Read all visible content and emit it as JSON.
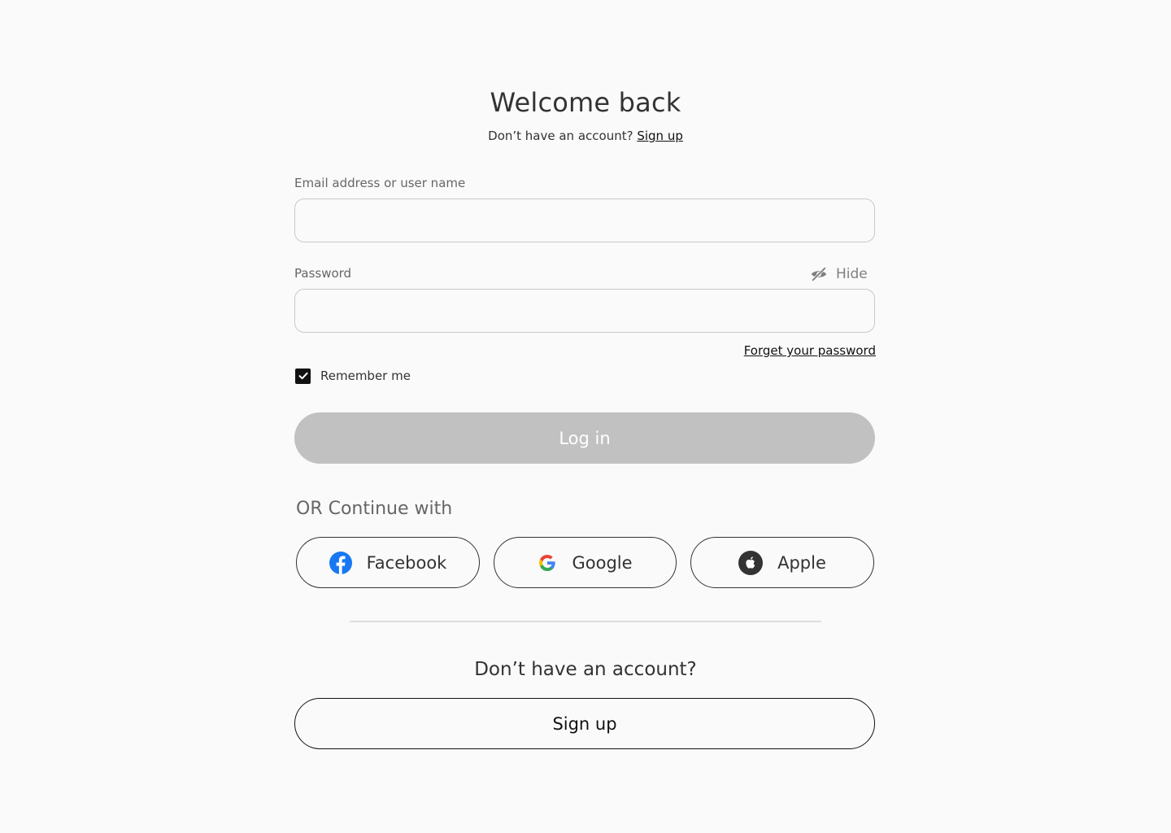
{
  "header": {
    "title": "Welcome back",
    "subtitle_prefix": "Don’t have an account?",
    "signup_link": "Sign up"
  },
  "form": {
    "email": {
      "label": "Email address or user name",
      "value": "",
      "placeholder": ""
    },
    "password": {
      "label": "Password",
      "value": "",
      "placeholder": "",
      "toggle_label": "Hide",
      "toggle_icon": "eye-slash-icon"
    },
    "forgot_link": "Forget your password",
    "remember": {
      "label": "Remember me",
      "checked": true
    },
    "login_button": "Log in"
  },
  "social": {
    "heading": "OR Continue with",
    "providers": [
      {
        "label": "Facebook",
        "icon": "facebook-icon",
        "color": "#1877F2"
      },
      {
        "label": "Google",
        "icon": "google-icon"
      },
      {
        "label": "Apple",
        "icon": "apple-icon",
        "color": "#333333"
      }
    ]
  },
  "footer": {
    "question": "Don’t have an account?",
    "signup_button": "Sign up"
  },
  "colors": {
    "background": "#FAFAFA",
    "text": "#333333",
    "muted": "#666666",
    "disabled_button": "#C1C1C1",
    "border": "#C9C9C9"
  }
}
